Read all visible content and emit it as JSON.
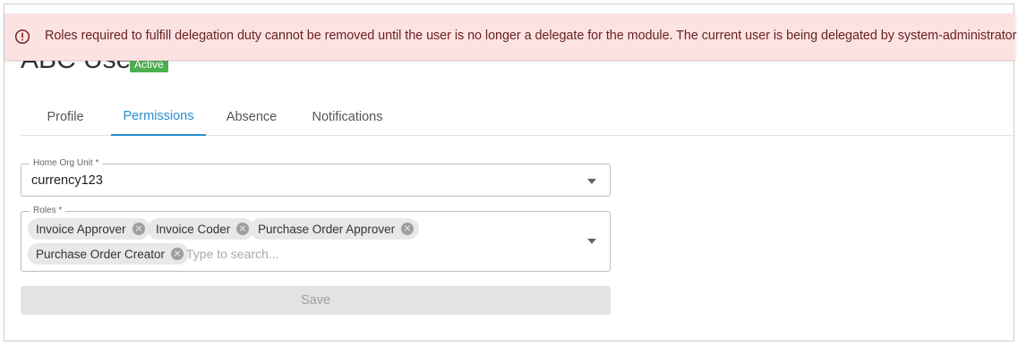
{
  "alert": {
    "icon": "warning-circle-icon",
    "message": "Roles required to fulfill delegation duty cannot be removed until the user is no longer a delegate for the module. The current user is being delegated by system-administrator User."
  },
  "user": {
    "name": "ABC User",
    "status": "Active",
    "status_color": "#4caf50"
  },
  "tabs": [
    {
      "label": "Profile",
      "active": false
    },
    {
      "label": "Permissions",
      "active": true
    },
    {
      "label": "Absence",
      "active": false
    },
    {
      "label": "Notifications",
      "active": false
    }
  ],
  "accent_color": "#2a8ed0",
  "form": {
    "home_org_unit": {
      "label": "Home Org Unit *",
      "value": "currency123"
    },
    "roles": {
      "label": "Roles *",
      "selected": [
        "Invoice Approver",
        "Invoice Coder",
        "Purchase Order Approver",
        "Purchase Order Creator"
      ],
      "placeholder": "Type to search..."
    },
    "save_label": "Save",
    "save_disabled": true
  }
}
